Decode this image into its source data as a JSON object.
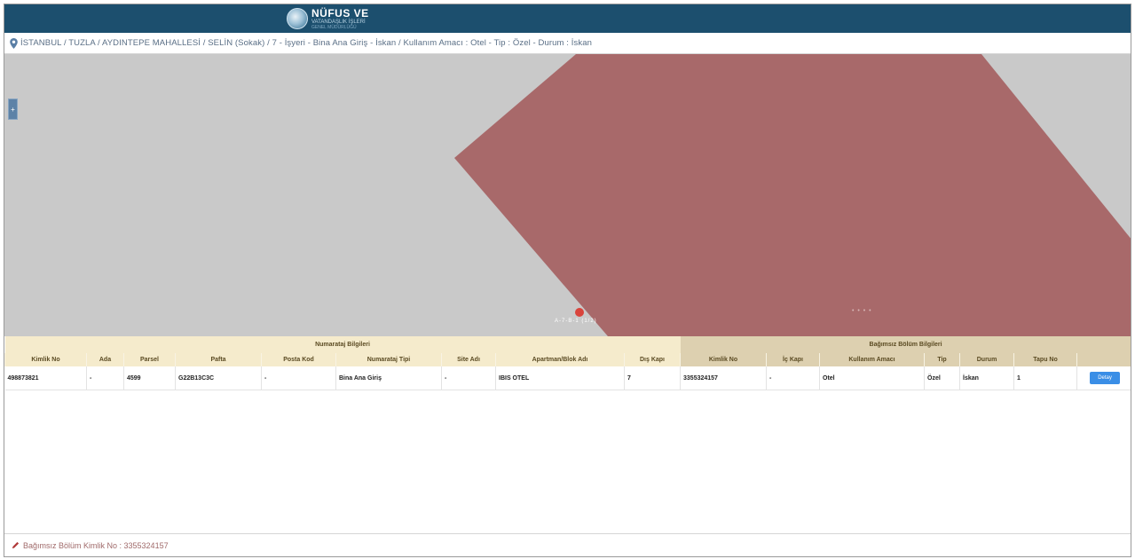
{
  "header": {
    "logo_title": "NÜFUS VE",
    "logo_subtitle": "VATANDAŞLIK İŞLERİ",
    "logo_sub2": "GENEL MÜDÜRLÜĞÜ"
  },
  "address": {
    "icon": "map-marker-icon",
    "text": "İSTANBUL / TUZLA / AYDINTEPE MAHALLESİ / SELİN (Sokak) / 7 - İşyeri - Bina Ana Giriş - İskan / Kullanım Amacı : Otel - Tip : Özel - Durum : İskan"
  },
  "map": {
    "zoom_label": "+",
    "marker_label": "A-7-B-1 (1/2)",
    "dots_label": "• • • •",
    "colors": {
      "background": "#c9c9c9",
      "parcel": "#a8696a",
      "marker": "#d9443c"
    }
  },
  "table": {
    "group_headers": [
      "Numarataj Bilgileri",
      "Bağımsız Bölüm Bilgileri"
    ],
    "columns": [
      "Kimlik No",
      "Ada",
      "Parsel",
      "Pafta",
      "Posta Kod",
      "Numarataj Tipi",
      "Site Adı",
      "Apartman/Blok Adı",
      "Dış Kapı",
      "Kimlik No",
      "İç Kapı",
      "Kullanım Amacı",
      "Tip",
      "Durum",
      "Tapu No",
      ""
    ],
    "rows": [
      {
        "cells": [
          "498873821",
          "-",
          "4599",
          "G22B13C3C",
          "-",
          "Bina Ana Giriş",
          "-",
          "IBIS OTEL",
          "7",
          "3355324157",
          "-",
          "Otel",
          "Özel",
          "İskan",
          "1"
        ],
        "button_label": "Detay"
      }
    ]
  },
  "status": {
    "icon": "pencil-icon",
    "text": "Bağımsız Bölüm Kimlik No : 3355324157"
  }
}
